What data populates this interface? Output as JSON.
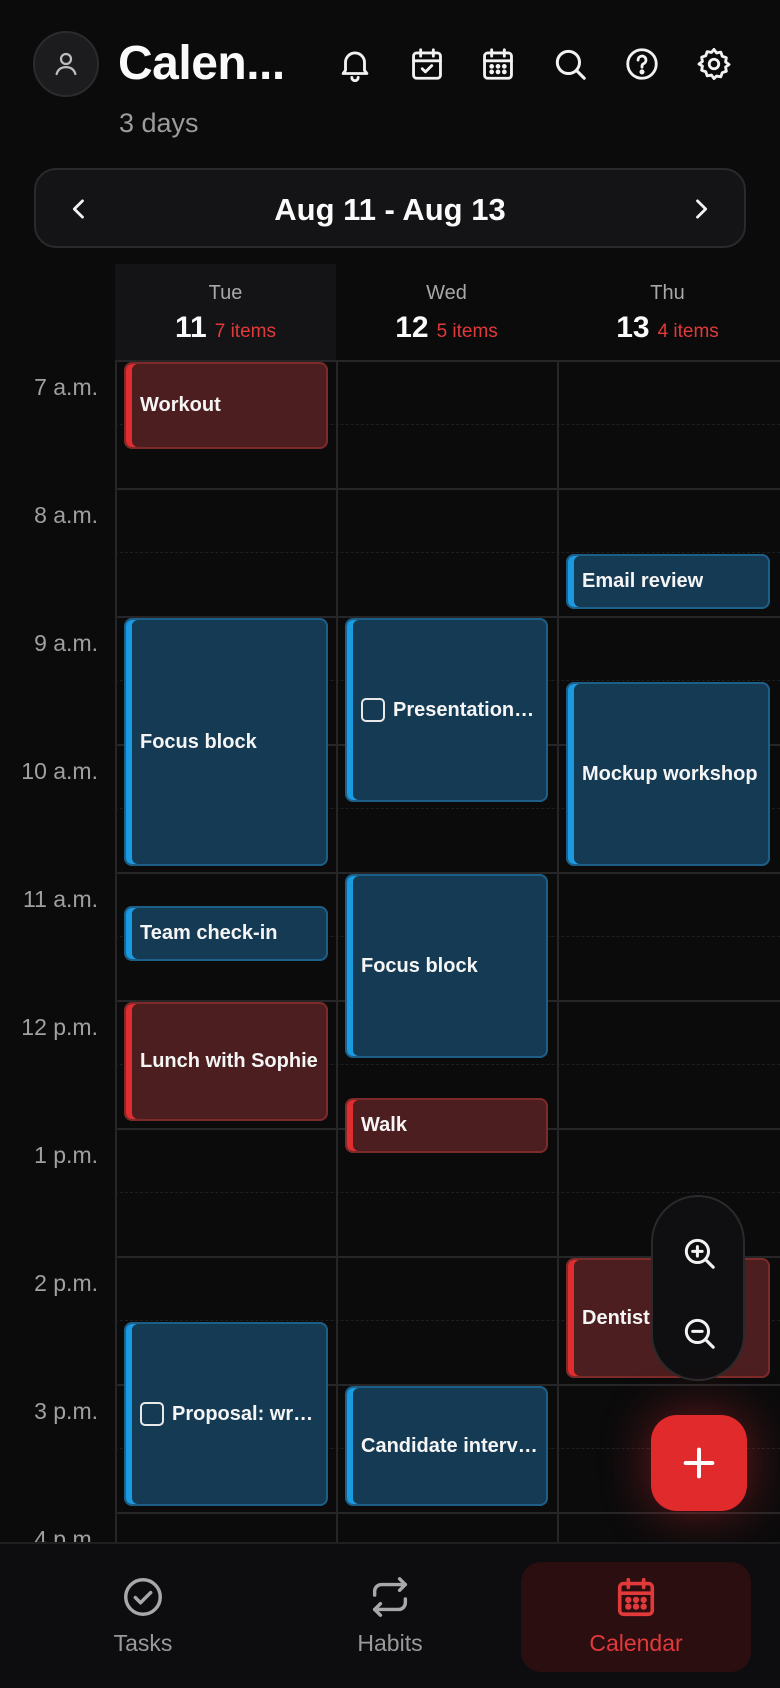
{
  "header": {
    "title": "Calen...",
    "subtitle": "3 days",
    "icons": [
      "user-icon",
      "bell-icon",
      "calendar-check-icon",
      "calendar-grid-icon",
      "search-icon",
      "help-icon",
      "gear-icon"
    ]
  },
  "range": {
    "label": "Aug 11 - Aug 13"
  },
  "days": [
    {
      "name": "Tue",
      "num": "11",
      "count": "7 items",
      "selected": true
    },
    {
      "name": "Wed",
      "num": "12",
      "count": "5 items",
      "selected": false
    },
    {
      "name": "Thu",
      "num": "13",
      "count": "4 items",
      "selected": false
    }
  ],
  "times": [
    "7 a.m.",
    "8 a.m.",
    "9 a.m.",
    "10 a.m.",
    "11 a.m.",
    "12 p.m.",
    "1 p.m.",
    "2 p.m.",
    "3 p.m.",
    "4 p.m."
  ],
  "events": {
    "tue": {
      "workout": "Workout",
      "focus": "Focus block",
      "checkin": "Team check-in",
      "lunch": "Lunch with Sophie",
      "proposal": "Proposal: writi..."
    },
    "wed": {
      "presentation": "Presentation t...",
      "focus": "Focus block",
      "walk": "Walk",
      "candidate": "Candidate intervi..."
    },
    "thu": {
      "email": "Email review",
      "mockup": "Mockup workshop",
      "dentist": "Dentist"
    }
  },
  "nav": {
    "tasks": "Tasks",
    "habits": "Habits",
    "calendar": "Calendar"
  },
  "colors": {
    "accent": "#e02a2c",
    "event_blue": "#153a54",
    "event_red": "#4c1e1f"
  }
}
